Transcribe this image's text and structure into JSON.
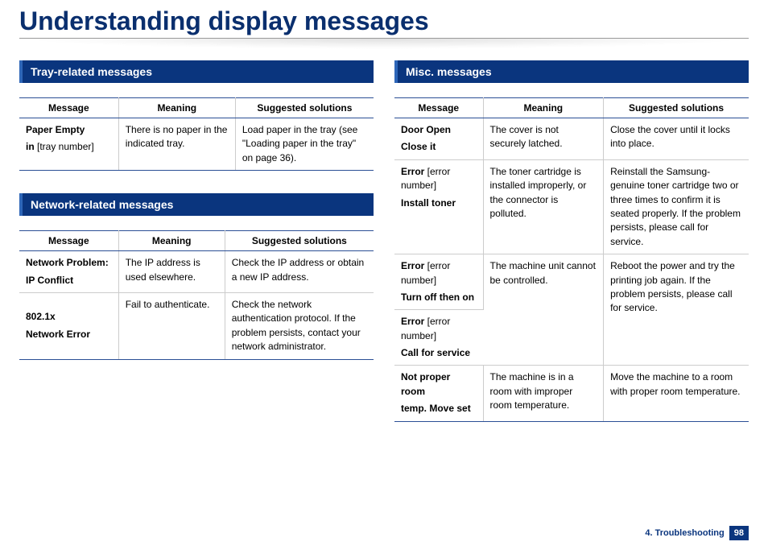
{
  "title": "Understanding display messages",
  "footer": {
    "chapter": "4. Troubleshooting",
    "page": "98"
  },
  "left": {
    "sections": [
      {
        "heading": "Tray-related messages",
        "headers": [
          "Message",
          "Meaning",
          "Suggested solutions"
        ],
        "rows": [
          {
            "msg_bold": "Paper Empty",
            "msg_rest_bold": "in",
            "msg_rest_plain": " [tray number]",
            "meaning": "There is no paper in the indicated tray.",
            "solution": "Load paper in the tray (see \"Loading paper in the tray\" on page 36)."
          }
        ]
      },
      {
        "heading": "Network-related messages",
        "headers": [
          "Message",
          "Meaning",
          "Suggested solutions"
        ],
        "rows": [
          {
            "msg_bold": "Network Problem:",
            "msg_rest_bold": "IP Conflict",
            "msg_rest_plain": "",
            "meaning": "The IP address is used elsewhere.",
            "solution": "Check the IP address or obtain a new IP address."
          },
          {
            "msg_bold": "802.1x",
            "msg_rest_bold": "Network Error",
            "msg_rest_plain": "",
            "meaning": "Fail to authenticate.",
            "solution": "Check the network authentication protocol. If the problem persists, contact your network administrator."
          }
        ]
      }
    ]
  },
  "right": {
    "sections": [
      {
        "heading": "Misc. messages",
        "headers": [
          "Message",
          "Meaning",
          "Suggested solutions"
        ],
        "rows": [
          {
            "msg_bold": "Door Open",
            "msg_rest_bold": "Close it",
            "msg_rest_plain": "",
            "meaning": "The cover is not securely latched.",
            "solution": "Close the cover until it locks into place."
          },
          {
            "msg_bold": "Error",
            "msg_bold_tail": " [error number]",
            "msg_rest_bold": "Install toner",
            "msg_rest_plain": "",
            "meaning": "The toner cartridge is installed improperly, or the connector is polluted.",
            "solution": "Reinstall the Samsung-genuine toner cartridge two or three times to confirm it is seated properly. If the problem persists, please call for service."
          },
          {
            "msg_bold": "Error",
            "msg_bold_tail": " [error number]",
            "msg_rest_bold": "Turn off then on",
            "msg_rest_plain": "",
            "meaning": "The machine unit cannot be controlled.",
            "solution": "Reboot the power and try the printing job again. If the problem persists, please call for service."
          },
          {
            "msg_bold": "Error",
            "msg_bold_tail": " [error number]",
            "msg_rest_bold": "Call for service",
            "msg_rest_plain": "",
            "meaning": "",
            "solution": ""
          },
          {
            "msg_bold": "Not proper room",
            "msg_rest_bold": "temp. Move set",
            "msg_rest_plain": "",
            "meaning": "The machine is in a room with improper room temperature.",
            "solution": "Move the machine to a room with proper room temperature."
          }
        ]
      }
    ]
  }
}
